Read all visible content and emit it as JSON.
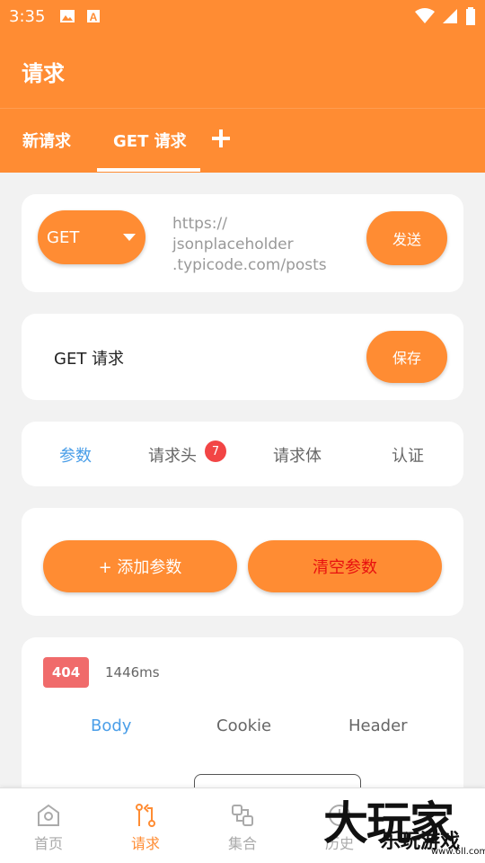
{
  "status_bar": {
    "time": "3:35"
  },
  "app_bar": {
    "title": "请求"
  },
  "top_tabs": {
    "tab1": "新请求",
    "tab2": "GET 请求",
    "add_icon": "plus-icon"
  },
  "request_card": {
    "method": "GET",
    "url": "https://\njsonplaceholder\n.typicode.com/posts",
    "send_label": "发送"
  },
  "name_card": {
    "name": "GET 请求",
    "save_label": "保存"
  },
  "sub_tabs": {
    "params": "参数",
    "headers": "请求头",
    "headers_badge": "7",
    "body": "请求体",
    "auth": "认证"
  },
  "params_card": {
    "add_label": "+ 添加参数",
    "clear_label": "清空参数"
  },
  "response": {
    "status_code": "404",
    "time": "1446ms",
    "tab_body": "Body",
    "tab_cookie": "Cookie",
    "tab_header": "Header"
  },
  "bottom_nav": {
    "home": "首页",
    "request": "请求",
    "collection": "集合",
    "history": "历史"
  },
  "watermark": {
    "big": "大玩家",
    "small": "乐玩游戏",
    "url": "www.6ll.com"
  },
  "colors": {
    "accent": "#ff8c33",
    "active_tab": "#4a9ee8",
    "badge": "#f24545",
    "status_404": "#f06b6b",
    "clear_text": "#e8110f"
  }
}
